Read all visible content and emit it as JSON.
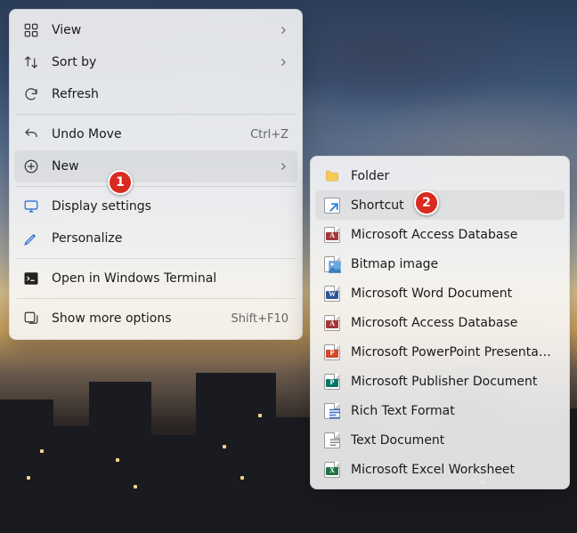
{
  "menu1": {
    "view": "View",
    "sort": "Sort by",
    "refresh": "Refresh",
    "undo": "Undo Move",
    "undo_shortcut": "Ctrl+Z",
    "new": "New",
    "display": "Display settings",
    "personalize": "Personalize",
    "terminal": "Open in Windows Terminal",
    "more": "Show more options",
    "more_shortcut": "Shift+F10"
  },
  "menu2": {
    "folder": "Folder",
    "shortcut": "Shortcut",
    "accessdb1": "Microsoft Access Database",
    "bitmap": "Bitmap image",
    "word": "Microsoft Word Document",
    "accessdb2": "Microsoft Access Database",
    "powerpoint": "Microsoft PowerPoint Presentation",
    "publisher": "Microsoft Publisher Document",
    "rtf": "Rich Text Format",
    "text": "Text Document",
    "excel": "Microsoft Excel Worksheet"
  },
  "annotations": {
    "a1": "1",
    "a2": "2"
  }
}
